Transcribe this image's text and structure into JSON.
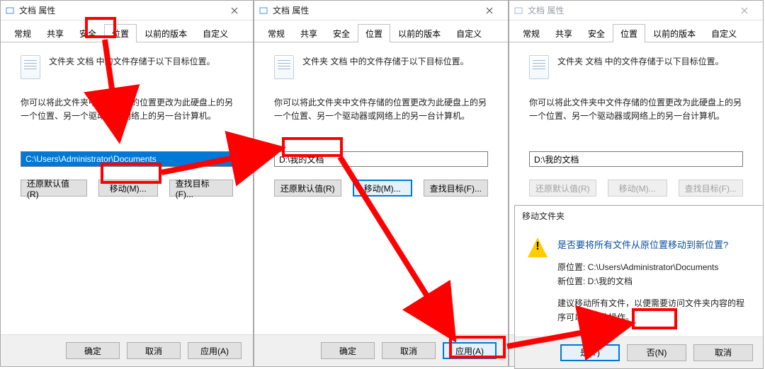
{
  "dialog": {
    "title": "文档 属性",
    "tabs": [
      "常规",
      "共享",
      "安全",
      "位置",
      "以前的版本",
      "自定义"
    ],
    "active_tab": "位置",
    "msg1": "文件夹 文档 中的文件存储于以下目标位置。",
    "desc": "你可以将此文件夹中文件存储的位置更改为此硬盘上的另一个位置、另一个驱动器或网络上的另一台计算机。",
    "path_a": "C:\\Users\\Administrator\\Documents",
    "path_b": "D:\\我的文档",
    "path_c": "D:\\我的文档",
    "btn_restore": "还原默认值(R)",
    "btn_move": "移动(M)...",
    "btn_find": "查找目标(F)...",
    "footer_ok": "确定",
    "footer_cancel": "取消",
    "footer_apply": "应用(A)"
  },
  "confirm": {
    "title": "移动文件夹",
    "question": "是否要将所有文件从原位置移动到新位置?",
    "old_label": "原位置: C:\\Users\\Administrator\\Documents",
    "new_label": "新位置: D:\\我的文档",
    "advice": "建议移动所有文件，以便需要访问文件夹内容的程序可以执行此操作。",
    "yes": "是(Y)",
    "no": "否(N)",
    "cancel": "取消"
  }
}
